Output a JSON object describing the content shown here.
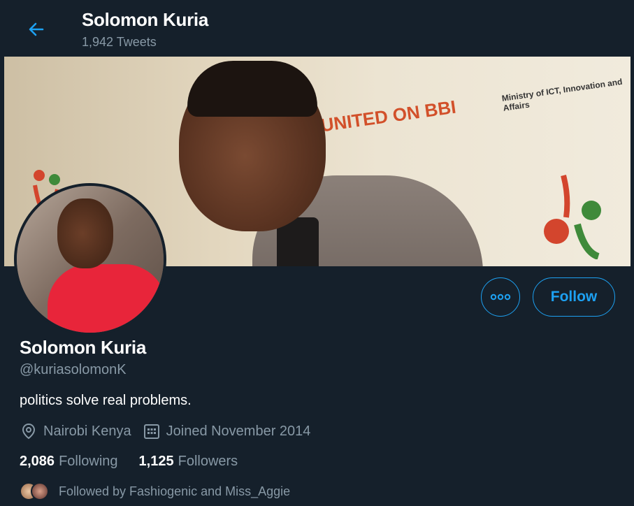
{
  "header": {
    "title": "Solomon Kuria",
    "tweet_count": "1,942 Tweets"
  },
  "banner": {
    "text_primary": "UNITED ON BBI",
    "text_secondary": "Ministry of ICT, Innovation and Affairs"
  },
  "actions": {
    "follow_label": "Follow"
  },
  "profile": {
    "name": "Solomon Kuria",
    "handle": "@kuriasolomonK",
    "bio": "politics solve real problems.",
    "location": "Nairobi Kenya",
    "joined": "Joined November 2014",
    "following_count": "2,086",
    "following_label": "Following",
    "followers_count": "1,125",
    "followers_label": "Followers",
    "followed_by": "Followed by Fashiogenic and Miss_Aggie"
  },
  "colors": {
    "background": "#15202b",
    "accent": "#1da1f2",
    "secondary_text": "#8899a6"
  },
  "icons": {
    "back": "arrow-left-icon",
    "more": "more-dots-icon",
    "location": "location-pin-icon",
    "calendar": "calendar-icon"
  }
}
